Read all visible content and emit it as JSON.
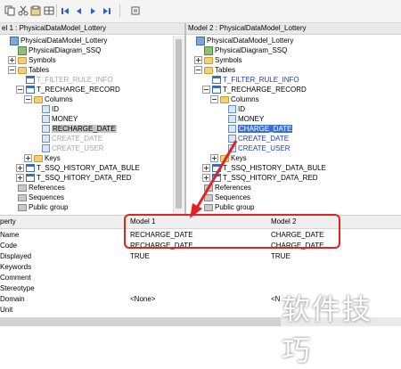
{
  "toolbar": {
    "buttons": [
      "copy-icon",
      "cut-icon",
      "paste-icon",
      "first-icon",
      "previous-icon",
      "next-icon",
      "last-icon",
      "options-icon"
    ]
  },
  "left_pane": {
    "header": "el 1 : PhysicalDataModel_Lottery",
    "rows": [
      {
        "text": "PhysicalDataModel_Lottery",
        "style": ""
      },
      {
        "text": "PhysicalDiagram_SSQ",
        "style": ""
      },
      {
        "text": "Symbols",
        "style": ""
      },
      {
        "text": "Tables",
        "style": ""
      },
      {
        "text": "T_FILTER_RULE_INFO",
        "style": "gray"
      },
      {
        "text": "T_RECHARGE_RECORD",
        "style": ""
      },
      {
        "text": "Columns",
        "style": ""
      },
      {
        "text": "ID",
        "style": ""
      },
      {
        "text": "MONEY",
        "style": ""
      },
      {
        "text": "RECHARGE_DATE",
        "style": "selgray"
      },
      {
        "text": "CREATE_DATE",
        "style": "gray"
      },
      {
        "text": "CREATE_USER",
        "style": "gray"
      },
      {
        "text": "Keys",
        "style": ""
      },
      {
        "text": "T_SSQ_HISTORY_DATA_BULE",
        "style": ""
      },
      {
        "text": "T_SSQ_HITORY_DATA_RED",
        "style": ""
      },
      {
        "text": "References",
        "style": ""
      },
      {
        "text": "Sequences",
        "style": ""
      },
      {
        "text": "Public group",
        "style": ""
      }
    ]
  },
  "right_pane": {
    "header": "Model 2 : PhysicalDataModel_Lottery",
    "rows": [
      {
        "text": "PhysicalDataModel_Lottery",
        "style": ""
      },
      {
        "text": "PhysicalDiagram_SSQ",
        "style": ""
      },
      {
        "text": "Symbols",
        "style": ""
      },
      {
        "text": "Tables",
        "style": ""
      },
      {
        "text": "T_FILTER_RULE_INFO",
        "style": "blue"
      },
      {
        "text": "T_RECHARGE_RECORD",
        "style": ""
      },
      {
        "text": "Columns",
        "style": ""
      },
      {
        "text": "ID",
        "style": ""
      },
      {
        "text": "MONEY",
        "style": ""
      },
      {
        "text": "CHARGE_DATE",
        "style": "sel"
      },
      {
        "text": "CREATE_DATE",
        "style": "blue"
      },
      {
        "text": "CREATE_USER",
        "style": "blue"
      },
      {
        "text": "Keys",
        "style": ""
      },
      {
        "text": "T_SSQ_HISTORY_DATA_BULE",
        "style": ""
      },
      {
        "text": "T_SSQ_HITORY_DATA_RED",
        "style": ""
      },
      {
        "text": "References",
        "style": ""
      },
      {
        "text": "Sequences",
        "style": ""
      },
      {
        "text": "Public group",
        "style": ""
      }
    ]
  },
  "properties": {
    "header": {
      "property": "perty",
      "model1": "Model 1",
      "model2": "Model 2"
    },
    "rows": [
      {
        "name": "Name",
        "model1": "RECHARGE_DATE",
        "model2": "CHARGE_DATE"
      },
      {
        "name": "Code",
        "model1": "RECHARGE_DATE",
        "model2": "CHARGE_DATE"
      },
      {
        "name": "Displayed",
        "model1": "TRUE",
        "model2": "TRUE"
      },
      {
        "name": "Keywords",
        "model1": "",
        "model2": ""
      },
      {
        "name": "Comment",
        "model1": "",
        "model2": ""
      },
      {
        "name": "Stereotype",
        "model1": "",
        "model2": ""
      },
      {
        "name": "Domain",
        "model1": "<None>",
        "model2": "<N"
      },
      {
        "name": "Unit",
        "model1": "",
        "model2": ""
      }
    ]
  },
  "watermark": "软件技巧",
  "colors": {
    "highlight_box": "#e52020",
    "selection": "#3e6fd6",
    "changed_text": "#1a3cc9"
  }
}
